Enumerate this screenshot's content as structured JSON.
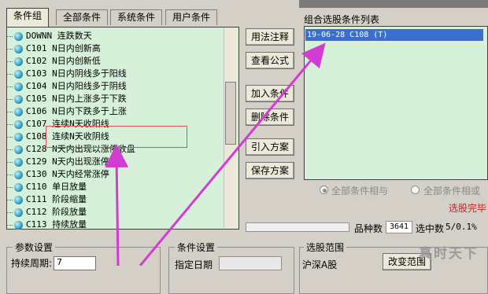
{
  "tabs": [
    "条件组",
    "全部条件",
    "系统条件",
    "用户条件"
  ],
  "list_items": [
    "DOWNN 连跌数天",
    "C101 N日内创新高",
    "C102 N日内创新低",
    "C103 N日内阴线多于阳线",
    "C104 N日内阳线多于阴线",
    "C105 N日内上涨多于下跌",
    "C106 N日内下跌多于上涨",
    "C107 连续N天收阳线",
    "C108 连续N天收阴线",
    "C128 N天内出现以涨停收盘",
    "C129 N天内出现涨停",
    "C130 N天内经常涨停",
    "C110 单日放量",
    "C111 阶段缩量",
    "C112 阶段放量",
    "C113 持续放量"
  ],
  "buttons": {
    "usage_note": "用法注释",
    "view_formula": "查看公式",
    "add_condition": "加入条件",
    "delete_condition": "删除条件",
    "import_plan": "引入方案",
    "save_plan": "保存方案"
  },
  "right_panel": {
    "label": "组合选股条件列表",
    "items": [
      "19-06-28 C108 (T)"
    ]
  },
  "radios": {
    "and_label": "全部条件相与",
    "or_label": "全部条件相或",
    "and_selected": true
  },
  "status": {
    "done": "选股完毕",
    "count_label": "品种数",
    "count_value": "3641",
    "selected_label": "选中数",
    "selected_value": "5/0.1%"
  },
  "bottom": {
    "param_title": "参数设置",
    "period_label": "持续周期:",
    "period_value": "7",
    "cond_title": "条件设置",
    "date_label": "指定日期",
    "range_title": "选股范围",
    "range_value": "沪深A股",
    "change_range": "改变范围"
  },
  "watermark": "真时天下",
  "colors": {
    "list_bg": "#d6f0d9",
    "selection": "#3a6fcf",
    "arrow": "#d23cd2",
    "done_text": "#d02020",
    "highlight_box": "#e05050"
  }
}
